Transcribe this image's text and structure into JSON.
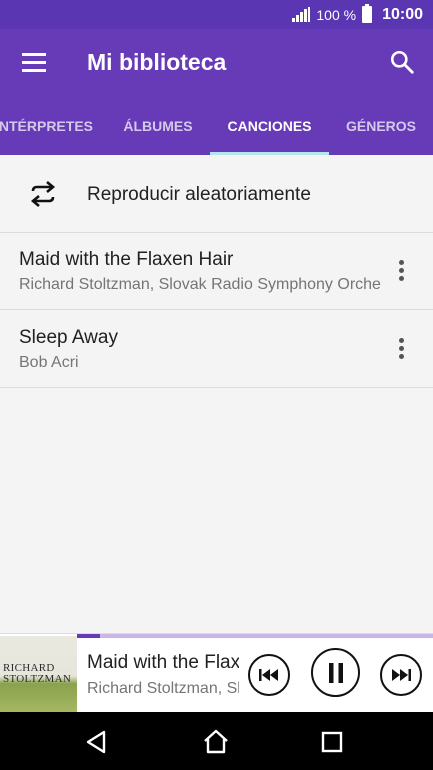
{
  "status_bar": {
    "battery_percent": "100 %",
    "time": "10:00",
    "icons": [
      "signal-icon",
      "battery-icon"
    ]
  },
  "app_bar": {
    "title": "Mi biblioteca",
    "icons": [
      "menu-icon",
      "search-icon"
    ]
  },
  "tabs": [
    {
      "label": "INTÉRPRETES",
      "active": false
    },
    {
      "label": "ÁLBUMES",
      "active": false
    },
    {
      "label": "CANCIONES",
      "active": true
    },
    {
      "label": "GÉNEROS",
      "active": false
    }
  ],
  "shuffle": {
    "label": "Reproducir aleatoriamente",
    "icon": "shuffle-repeat-icon"
  },
  "songs": [
    {
      "title": "Maid with the Flaxen Hair",
      "artist": "Richard Stoltzman, Slovak Radio Symphony Orchestra"
    },
    {
      "title": "Sleep Away",
      "artist": "Bob Acri"
    }
  ],
  "now_playing": {
    "title": "Maid with the Flaxen Hair",
    "artist": "Richard Stoltzman, Slovak Radio Symphony Orchestra",
    "album_art_text_1": "RICHARD",
    "album_art_text_2": "STOLTZMAN",
    "progress": 0.065
  },
  "colors": {
    "status_bar": "#5a36b3",
    "app_bar": "#673ab7",
    "tab_indicator": "#b6e6ec",
    "background": "#f4f4f4"
  }
}
